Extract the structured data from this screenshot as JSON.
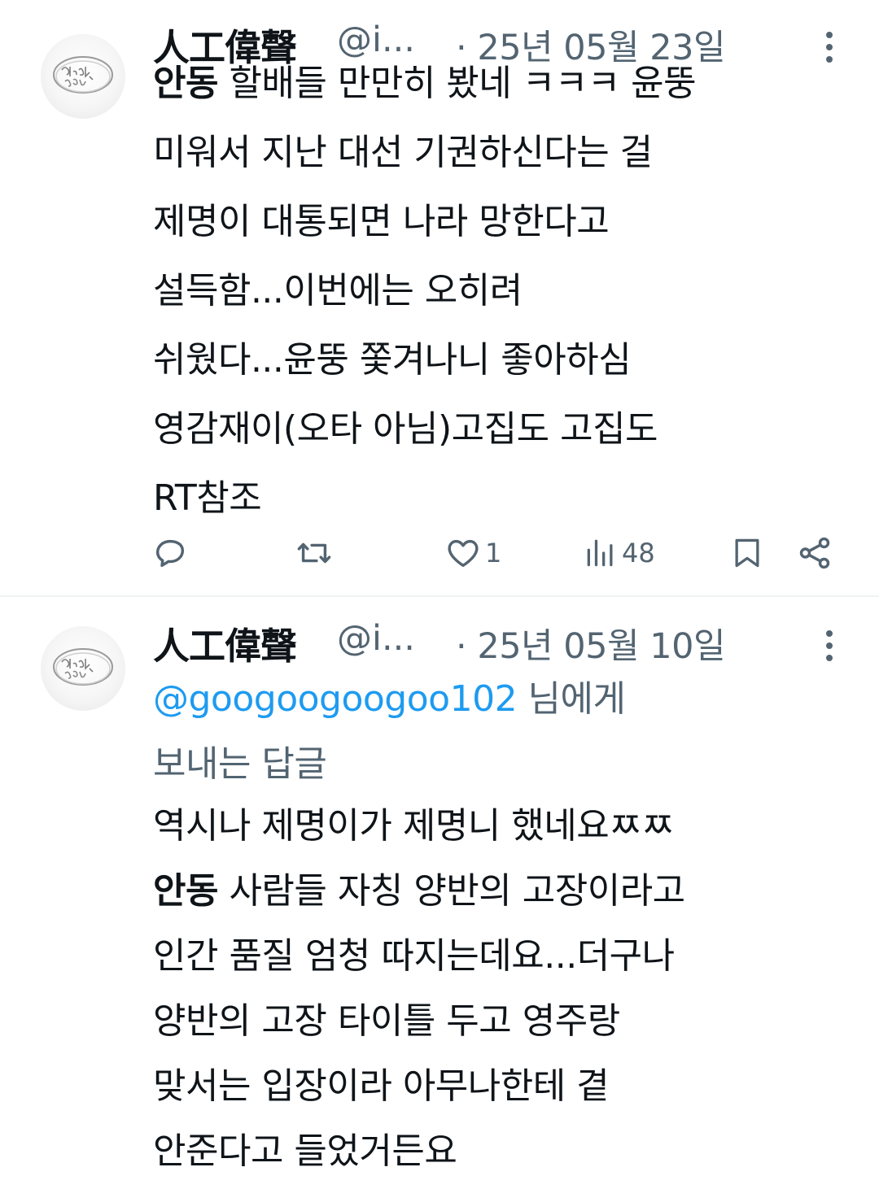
{
  "tweets": [
    {
      "author": {
        "name": "人工偉聲",
        "handle": "@i...",
        "avatar_text": "fuck you"
      },
      "date": "· 25년 05월 23일",
      "more_icon": "more-vertical-icon",
      "body": [
        [
          {
            "text": "안동",
            "bold": true
          },
          {
            "text": " 할배들 만만히 봤네 ㅋㅋㅋ 윤뚱"
          }
        ],
        [
          {
            "text": "미워서 지난 대선 기권하신다는 걸"
          }
        ],
        [
          {
            "text": "제명이 대통되면 나라 망한다고"
          }
        ],
        [
          {
            "text": "설득함...이번에는 오히려"
          }
        ],
        [
          {
            "text": "쉬웠다...윤뚱 쫓겨나니 좋아하심"
          }
        ],
        [
          {
            "text": "영감재이(오타 아님)고집도 고집도"
          }
        ],
        [
          {
            "text": "RT참조"
          }
        ]
      ],
      "actions": {
        "reply": {
          "icon": "reply-icon",
          "count": ""
        },
        "retweet": {
          "icon": "retweet-icon",
          "count": ""
        },
        "like": {
          "icon": "heart-icon",
          "count": "1"
        },
        "views": {
          "icon": "views-icon",
          "count": "48"
        },
        "bookmark": {
          "icon": "bookmark-icon"
        },
        "share": {
          "icon": "share-icon"
        }
      }
    },
    {
      "author": {
        "name": "人工偉聲",
        "handle": "@i...",
        "avatar_text": "fuck you"
      },
      "date": "· 25년 05월 10일",
      "more_icon": "more-vertical-icon",
      "reply_to": {
        "mention": "@googoogoogoo102",
        "suffix_line1": " 님에게",
        "line2": "보내는 답글"
      },
      "body": [
        [
          {
            "text": "역시나 제명이가 제명니 했네요ㅉㅉ"
          }
        ],
        [
          {
            "text": "안동",
            "bold": true
          },
          {
            "text": " 사람들 자칭 양반의 고장이라고"
          }
        ],
        [
          {
            "text": "인간 품질  엄청 따지는데요...더구나"
          }
        ],
        [
          {
            "text": "양반의 고장 타이틀 두고 영주랑"
          }
        ],
        [
          {
            "text": "맞서는 입장이라 아무나한테 곁"
          }
        ],
        [
          {
            "text": "안준다고 들었거든요"
          }
        ]
      ]
    }
  ],
  "colors": {
    "text": "#0f1419",
    "secondary": "#536471",
    "link": "#1d9bf0",
    "divider": "#eff3f4"
  }
}
